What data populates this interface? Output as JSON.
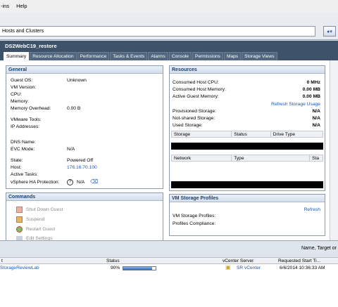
{
  "menubar": {
    "items": [
      "-ins",
      "Help"
    ]
  },
  "navigation": {
    "path": "Hosts and Clusters"
  },
  "vm": {
    "name": "DS2WebC19_restore"
  },
  "tabs": [
    "Summary",
    "Resource Allocation",
    "Performance",
    "Tasks & Events",
    "Alarms",
    "Console",
    "Permissions",
    "Maps",
    "Storage Views"
  ],
  "general": {
    "title": "General",
    "fields": [
      {
        "label": "Guest OS:",
        "value": "Unknown"
      },
      {
        "label": "VM Version:",
        "value": ""
      },
      {
        "label": "CPU:",
        "value": ""
      },
      {
        "label": "Memory:",
        "value": ""
      },
      {
        "label": "Memory Overhead:",
        "value": "0.00 B"
      },
      {
        "label": "VMware Tools:",
        "value": ""
      },
      {
        "label": "IP Addresses:",
        "value": ""
      },
      {
        "label": "DNS Name:",
        "value": ""
      },
      {
        "label": "EVC Mode:",
        "value": "N/A"
      },
      {
        "label": "State:",
        "value": "Powered Off"
      },
      {
        "label": "Host:",
        "value": "176.16.70.100"
      },
      {
        "label": "Active Tasks:",
        "value": ""
      },
      {
        "label": "vSphere HA Protection:",
        "value": "N/A"
      }
    ]
  },
  "commands": {
    "title": "Commands",
    "items": [
      "Shut Down Guest",
      "Suspend",
      "Restart Guest",
      "Edit Settings"
    ]
  },
  "resources": {
    "title": "Resources",
    "rows": [
      {
        "label": "Consumed Host CPU:",
        "value": "0 MHz"
      },
      {
        "label": "Consumed Host Memory:",
        "value": "0.00 MB"
      },
      {
        "label": "Active Guest Memory:",
        "value": "0.00 MB"
      }
    ],
    "refresh_link": "Refresh Storage Usage",
    "storage_rows": [
      {
        "label": "Provisioned Storage:",
        "value": "N/A"
      },
      {
        "label": "Not-shared Storage:",
        "value": "N/A"
      },
      {
        "label": "Used Storage:",
        "value": "N/A"
      }
    ],
    "storage_columns": [
      "Storage",
      "Status",
      "Drive Type"
    ],
    "network_columns": [
      "Network",
      "Type",
      "Sta"
    ]
  },
  "storage_profiles": {
    "title": "VM Storage Profiles",
    "refresh_link": "Refresh",
    "labels": [
      "VM Storage Profiles:",
      "Profiles Compliance:"
    ]
  },
  "tasks_panel": {
    "filter_label": "Name, Target or",
    "columns": [
      "t",
      "Status",
      "vCenter Server",
      "Requested Start Ti..."
    ],
    "row": {
      "target": "StorageReviewLab",
      "status": "90%",
      "progress": 90,
      "server": "SR vCenter",
      "start": "6/6/2014 10:36:33 AM"
    }
  }
}
